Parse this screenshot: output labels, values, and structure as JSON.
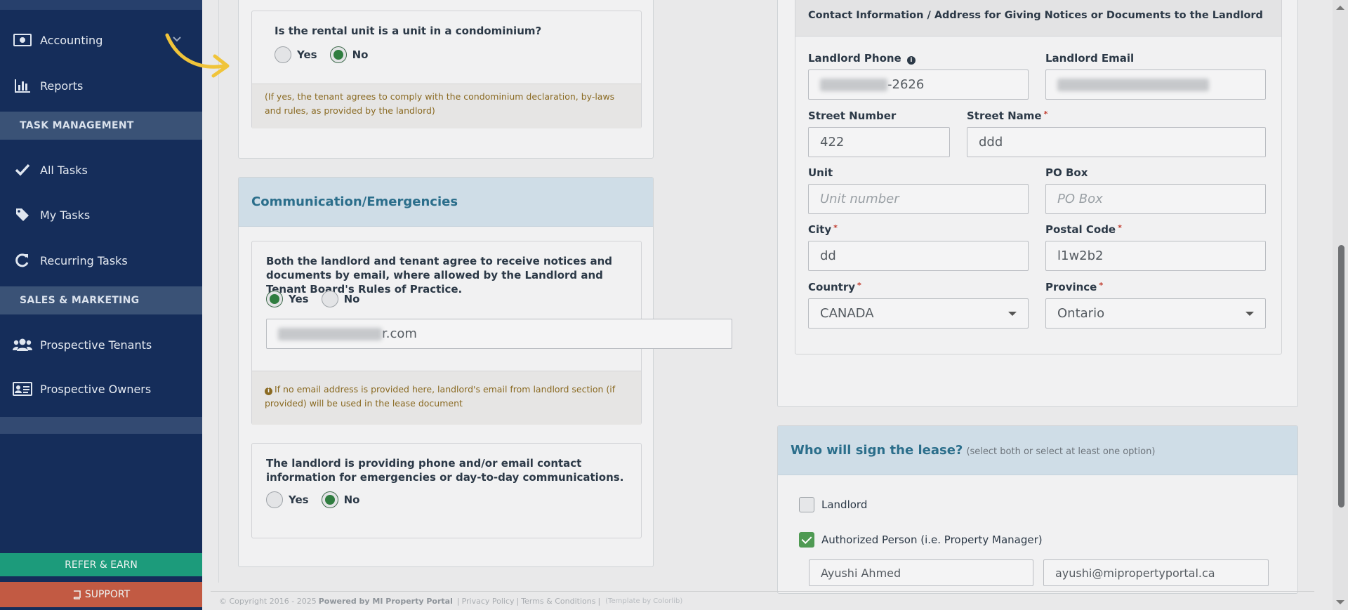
{
  "sidebar": {
    "items": [
      {
        "label": "Accounting",
        "icon": "money-icon"
      },
      {
        "label": "Reports",
        "icon": "bar-chart-icon"
      },
      {
        "label": "All Tasks",
        "icon": "checkmark-icon"
      },
      {
        "label": "My Tasks",
        "icon": "tag-icon"
      },
      {
        "label": "Recurring Tasks",
        "icon": "refresh-icon"
      },
      {
        "label": "Prospective Tenants",
        "icon": "users-icon"
      },
      {
        "label": "Prospective Owners",
        "icon": "id-card-icon"
      }
    ],
    "sections": {
      "task_management": "TASK MANAGEMENT",
      "sales_marketing": "SALES & MARKETING"
    },
    "refer_label": "REFER & EARN",
    "support_label": "SUPPORT"
  },
  "condo": {
    "question": "Is the rental unit is a unit in a condominium?",
    "yes": "Yes",
    "no": "No",
    "selected": "No",
    "note": "(If yes, the tenant agrees to comply with the condominium declaration, by-laws and rules, as provided by the landlord)"
  },
  "communication": {
    "title": "Communication/Emergencies",
    "email_question": "Both the landlord and tenant agree to receive notices and documents by email, where allowed by the Landlord and Tenant Board's Rules of Practice.",
    "email_yes": "Yes",
    "email_no": "No",
    "email_selected": "Yes",
    "email_value_suffix": "r.com",
    "email_note": "If no email address is provided here, landlord's email from landlord section (if provided) will be used in the lease document",
    "contact_question": "The landlord is providing phone and/or email contact information for emergencies or day-to-day communications.",
    "contact_yes": "Yes",
    "contact_no": "No",
    "contact_selected": "No"
  },
  "contact": {
    "header": "Contact Information / Address for Giving Notices or Documents to the Landlord",
    "phone_label": "Landlord Phone",
    "phone_value_suffix": "-2626",
    "email_label": "Landlord Email",
    "street_number_label": "Street Number",
    "street_number_value": "422",
    "street_name_label": "Street Name",
    "street_name_value": "ddd",
    "unit_label": "Unit",
    "unit_placeholder": "Unit number",
    "po_box_label": "PO Box",
    "po_box_placeholder": "PO Box",
    "city_label": "City",
    "city_value": "dd",
    "postal_label": "Postal Code",
    "postal_value": "l1w2b2",
    "country_label": "Country",
    "country_value": "CANADA",
    "province_label": "Province",
    "province_value": "Ontario",
    "required_mark": "*"
  },
  "sign": {
    "title": "Who will sign the lease?",
    "subtitle": "(select both or select at least one option)",
    "landlord_label": "Landlord",
    "landlord_checked": false,
    "authorized_label": "Authorized Person (i.e. Property Manager)",
    "authorized_checked": true,
    "name_value": "Ayushi Ahmed",
    "email_value": "ayushi@mipropertyportal.ca"
  },
  "footer": {
    "copyright": "© Copyright 2016 - 2025",
    "powered": "Powered by MI Property Portal",
    "privacy": "Privacy Policy",
    "terms": "Terms & Conditions",
    "template": "(Template by Colorlib)",
    "sep": "|"
  },
  "colors": {
    "sidebar_bg": "#152d5a",
    "accent_green": "#2f7d3f",
    "refer_btn": "#1c9b7b",
    "support_btn": "#c25a43",
    "title_blue": "#2b6e8b"
  }
}
